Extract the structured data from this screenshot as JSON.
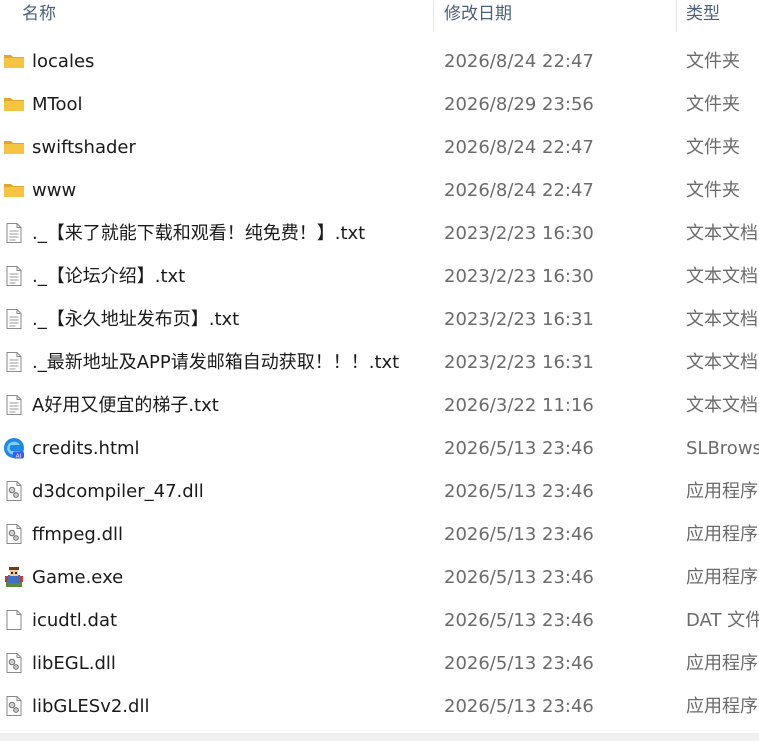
{
  "columns": {
    "name": "名称",
    "date": "修改日期",
    "type": "类型"
  },
  "files": [
    {
      "name": "locales",
      "date": "2026/8/24 22:47",
      "type": "文件夹",
      "icon": "folder-icon"
    },
    {
      "name": "MTool",
      "date": "2026/8/29 23:56",
      "type": "文件夹",
      "icon": "folder-icon"
    },
    {
      "name": "swiftshader",
      "date": "2026/8/24 22:47",
      "type": "文件夹",
      "icon": "folder-icon"
    },
    {
      "name": "www",
      "date": "2026/8/24 22:47",
      "type": "文件夹",
      "icon": "folder-icon"
    },
    {
      "name": "._【来了就能下载和观看！纯免费！】.txt",
      "date": "2023/2/23 16:30",
      "type": "文本文档",
      "icon": "text-file-icon"
    },
    {
      "name": "._【论坛介绍】.txt",
      "date": "2023/2/23 16:30",
      "type": "文本文档",
      "icon": "text-file-icon"
    },
    {
      "name": "._【永久地址发布页】.txt",
      "date": "2023/2/23 16:31",
      "type": "文本文档",
      "icon": "text-file-icon"
    },
    {
      "name": "._最新地址及APP请发邮箱自动获取！！！.txt",
      "date": "2023/2/23 16:31",
      "type": "文本文档",
      "icon": "text-file-icon"
    },
    {
      "name": "A好用又便宜的梯子.txt",
      "date": "2026/3/22 11:16",
      "type": "文本文档",
      "icon": "text-file-icon"
    },
    {
      "name": "credits.html",
      "date": "2026/5/13 23:46",
      "type": "SLBrowser",
      "icon": "browser-html-icon",
      "icon_badge": "AI"
    },
    {
      "name": "d3dcompiler_47.dll",
      "date": "2026/5/13 23:46",
      "type": "应用程序扩展",
      "icon": "dll-file-icon"
    },
    {
      "name": "ffmpeg.dll",
      "date": "2026/5/13 23:46",
      "type": "应用程序扩展",
      "icon": "dll-file-icon"
    },
    {
      "name": "Game.exe",
      "date": "2026/5/13 23:46",
      "type": "应用程序",
      "icon": "game-exe-icon"
    },
    {
      "name": "icudtl.dat",
      "date": "2026/5/13 23:46",
      "type": "DAT 文件",
      "icon": "blank-file-icon"
    },
    {
      "name": "libEGL.dll",
      "date": "2026/5/13 23:46",
      "type": "应用程序扩展",
      "icon": "dll-file-icon"
    },
    {
      "name": "libGLESv2.dll",
      "date": "2026/5/13 23:46",
      "type": "应用程序扩展",
      "icon": "dll-file-icon"
    }
  ],
  "colors": {
    "folder": "#f6c443",
    "folder_dark": "#e0a82b",
    "header_text": "#4c607a",
    "meta_text": "#6b6b6b"
  }
}
